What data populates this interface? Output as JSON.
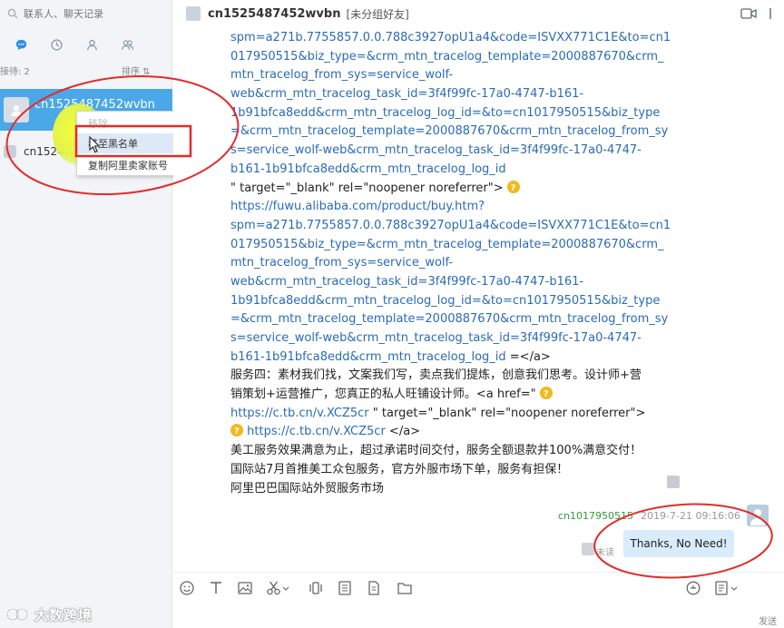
{
  "search": {
    "placeholder": "联系人、聊天记录"
  },
  "sidebar": {
    "tabs": [
      {
        "icon": "chat-bubble-icon"
      },
      {
        "icon": "clock-icon"
      },
      {
        "icon": "person-icon"
      },
      {
        "icon": "group-icon"
      }
    ],
    "contact_count": "接待: 2",
    "sort_label": "排序 ⇅",
    "contacts": [
      {
        "name": "cn1525487452wvbn",
        "selected": true
      },
      {
        "name": "cn15242",
        "selected": false
      }
    ]
  },
  "context_menu": {
    "items": [
      {
        "label": "移除"
      },
      {
        "label": "移至黑名单"
      },
      {
        "label": "复制阿里卖家账号"
      }
    ]
  },
  "header": {
    "peer_name": "cn1525487452wvbn",
    "peer_group": "[未分组好友]"
  },
  "messages": {
    "received_lines": [
      {
        "text": "spm=a271b.7755857.0.0.788c3927opU1a4&code=ISVXX771C1E&to=cn1",
        "type": "link"
      },
      {
        "text": "017950515&biz_type=&crm_mtn_tracelog_template=2000887670&crm_",
        "type": "link"
      },
      {
        "text": "mtn_tracelog_from_sys=service_wolf-",
        "type": "link"
      },
      {
        "text": "web&crm_mtn_tracelog_task_id=3f4f99fc-17a0-4747-b161-",
        "type": "link"
      },
      {
        "text": "1b91bfca8edd&crm_mtn_tracelog_log_id=&to=cn1017950515&biz_type",
        "type": "link"
      },
      {
        "text": "=&crm_mtn_tracelog_template=2000887670&crm_mtn_tracelog_from_sy",
        "type": "link"
      },
      {
        "text": "s=service_wolf-web&crm_mtn_tracelog_task_id=3f4f99fc-17a0-4747-",
        "type": "link"
      },
      {
        "text": "b161-1b91bfca8edd&crm_mtn_tracelog_log_id",
        "type": "link"
      },
      {
        "text": "\" target=\"_blank\" rel=\"noopener noreferrer\">",
        "type": "plain",
        "emoji_after": true
      },
      {
        "text": "https://fuwu.alibaba.com/product/buy.htm?",
        "type": "link"
      },
      {
        "text": "spm=a271b.7755857.0.0.788c3927opU1a4&code=ISVXX771C1E&to=cn1",
        "type": "link"
      },
      {
        "text": "017950515&biz_type=&crm_mtn_tracelog_template=2000887670&crm_",
        "type": "link"
      },
      {
        "text": "mtn_tracelog_from_sys=service_wolf-",
        "type": "link"
      },
      {
        "text": "web&crm_mtn_tracelog_task_id=3f4f99fc-17a0-4747-b161-",
        "type": "link"
      },
      {
        "text": "1b91bfca8edd&crm_mtn_tracelog_log_id=&to=cn1017950515&biz_type",
        "type": "link"
      },
      {
        "text": "=&crm_mtn_tracelog_template=2000887670&crm_mtn_tracelog_from_sy",
        "type": "link"
      },
      {
        "text": "s=service_wolf-web&crm_mtn_tracelog_task_id=3f4f99fc-17a0-4747-",
        "type": "link"
      },
      {
        "text": "b161-1b91bfca8edd&crm_mtn_tracelog_log_id",
        "type": "link",
        "suffix": " =</a>"
      },
      {
        "text": "服务四：素材我们找，文案我们写，卖点我们提炼，创意我们思考。设计师+营",
        "type": "plain"
      },
      {
        "text": "销策划+运营推广，您真正的私人旺铺设计师。<a href=\"",
        "type": "plain",
        "emoji_after": true
      },
      {
        "text": "https://c.tb.cn/v.XCZ5cr",
        "type": "link",
        "suffix": " \" target=\"_blank\" rel=\"noopener noreferrer\">"
      },
      {
        "text": "https://c.tb.cn/v.XCZ5cr",
        "type": "link",
        "emoji_before": true,
        "suffix": " </a>"
      },
      {
        "text": "美工服务效果满意为止，超过承诺时间交付，服务全额退款并100%满意交付！",
        "type": "plain"
      },
      {
        "text": "国际站7月首推美工众包服务，官方外服市场下单，服务有担保！",
        "type": "plain"
      },
      {
        "text": "阿里巴巴国际站外贸服务市场",
        "type": "plain"
      }
    ],
    "sent": {
      "user": "cn1017950515",
      "time": "2019-7-21 09:16:06",
      "text": "Thanks, No Need!",
      "status": "未读"
    }
  },
  "toolbar": {
    "tools": [
      {
        "icon": "emoji-icon"
      },
      {
        "icon": "text-font-icon"
      },
      {
        "icon": "image-icon"
      },
      {
        "icon": "scissors-icon"
      },
      {
        "icon": "shake-icon"
      },
      {
        "icon": "document-icon"
      },
      {
        "icon": "file-icon"
      },
      {
        "icon": "folder-icon"
      },
      {
        "icon": "history-icon"
      },
      {
        "icon": "settings-doc-icon"
      }
    ],
    "send_label": "发送"
  },
  "watermark": {
    "text": "大数跨境"
  },
  "colors": {
    "selected_contact": "#4aa8e8",
    "link": "#2a6bb8",
    "annotation_red": "#e32b2b",
    "sent_user": "#2e9b3c",
    "sent_bubble": "#d9ecfb"
  }
}
